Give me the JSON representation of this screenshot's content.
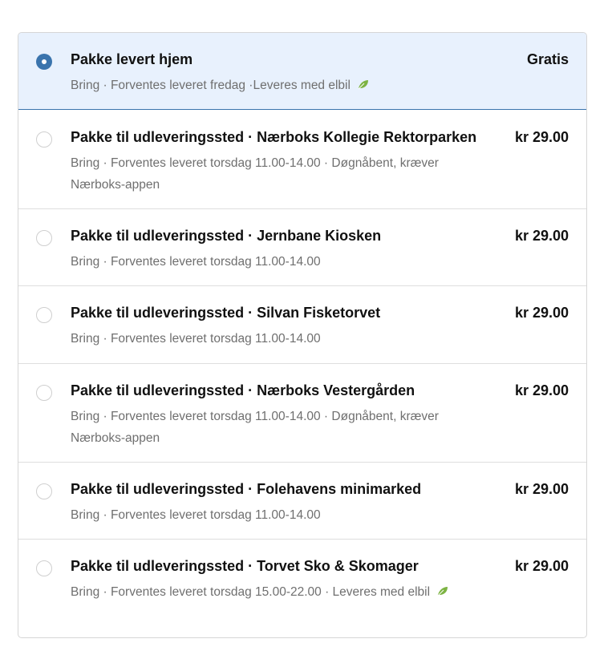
{
  "options": [
    {
      "title": "Pakke levert hjem",
      "price": "Gratis",
      "carrier": "Bring",
      "sep1": " · ",
      "eta": "Forventes leveret fredag",
      "sep2": " ·",
      "extra": "Leveres med elbil",
      "eco": true,
      "selected": true
    },
    {
      "title": "Pakke til udleveringssted · Nærboks Kollegie Rektorparken",
      "price": "kr 29.00",
      "carrier": "Bring",
      "sep1": "  · ",
      "eta": "Forventes leveret torsdag 11.00-14.00",
      "sep2": " · ",
      "extra": "Døgnåbent, kræver Nærboks-appen",
      "eco": false,
      "selected": false
    },
    {
      "title": "Pakke til udleveringssted · Jernbane Kiosken",
      "price": "kr 29.00",
      "carrier": "Bring",
      "sep1": "  · ",
      "eta": "Forventes leveret torsdag 11.00-14.00",
      "sep2": "",
      "extra": "",
      "eco": false,
      "selected": false
    },
    {
      "title": "Pakke til udleveringssted · Silvan Fisketorvet",
      "price": "kr 29.00",
      "carrier": "Bring",
      "sep1": "  · ",
      "eta": "Forventes leveret torsdag 11.00-14.00",
      "sep2": "",
      "extra": "",
      "eco": false,
      "selected": false
    },
    {
      "title": "Pakke til udleveringssted · Nærboks Vestergården",
      "price": "kr 29.00",
      "carrier": "Bring",
      "sep1": "  · ",
      "eta": "Forventes leveret torsdag 11.00-14.00",
      "sep2": " · ",
      "extra": "Døgnåbent, kræver Nærboks-appen",
      "eco": false,
      "selected": false
    },
    {
      "title": "Pakke til udleveringssted · Folehavens minimarked",
      "price": "kr 29.00",
      "carrier": "Bring",
      "sep1": "  · ",
      "eta": "Forventes leveret torsdag 11.00-14.00",
      "sep2": "",
      "extra": "",
      "eco": false,
      "selected": false
    },
    {
      "title": "Pakke til udleveringssted · Torvet Sko & Skomager",
      "price": "kr 29.00",
      "carrier": "Bring",
      "sep1": "  · ",
      "eta": "Forventes leveret torsdag 15.00-22.00",
      "sep2": " · ",
      "extra": "Leveres med elbil",
      "eco": true,
      "selected": false
    }
  ],
  "colors": {
    "selected_bg": "#e8f1fd",
    "accent": "#3a74ad",
    "eco_leaf": "#7cb342"
  },
  "icons": {
    "eco": "leaf-icon",
    "radio": "radio-icon"
  }
}
